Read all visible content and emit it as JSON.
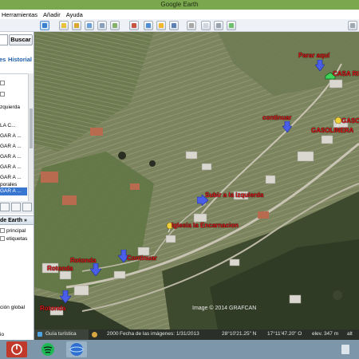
{
  "window": {
    "title": "Google Earth"
  },
  "menu": [
    "Herramientas",
    "Añadir",
    "Ayuda"
  ],
  "sidebar": {
    "search_button": "Buscar",
    "tabs": [
      "es",
      "Historial"
    ],
    "places": [
      {
        "label": "zquierda"
      },
      {
        "label": "LA C..."
      },
      {
        "label": "GAR A ..."
      },
      {
        "label": "GAR A ..."
      },
      {
        "label": "GAR A ..."
      },
      {
        "label": "GAR A ..."
      },
      {
        "label": "GAR A ..."
      },
      {
        "label": "porales"
      },
      {
        "label": "GAR A ..."
      }
    ],
    "layers_header": "de Earth »",
    "layers": [
      "principal",
      "etiquetas"
    ],
    "bottom_item": "ción global",
    "bottom_item2": "io"
  },
  "map": {
    "labels": {
      "parar_aqui": "Parar aquí",
      "casa": "CASA RI",
      "continuar_top": "continuar",
      "gasolinera_a": "GASOLINERA",
      "gasolinera_b": "GASOLINERA",
      "izquierda": "Subir a la izquierda",
      "iglesia": "Iglesia la Encarnacion",
      "continuar_mid": "Continuar",
      "rotonda_1": "Rotonda",
      "rotonda_2": "Rotonda",
      "rotonda_3": "Rotonda"
    },
    "copyright": "Image © 2014 GRAFCAN"
  },
  "status": {
    "tour": "Guía turística",
    "year": "2000",
    "imagery_date": "Fecha de las imágenes: 1/31/2013",
    "lat": "28°10'21.25\" N",
    "lon": "17°11'47.20\" O",
    "elev": "elev.  347 m",
    "alt": "alt"
  },
  "colors": {
    "titlebar": "#7ba84f",
    "label_red": "#e01818",
    "arrow_blue": "#4a5ee8",
    "taskbar": "#7d96aa"
  }
}
